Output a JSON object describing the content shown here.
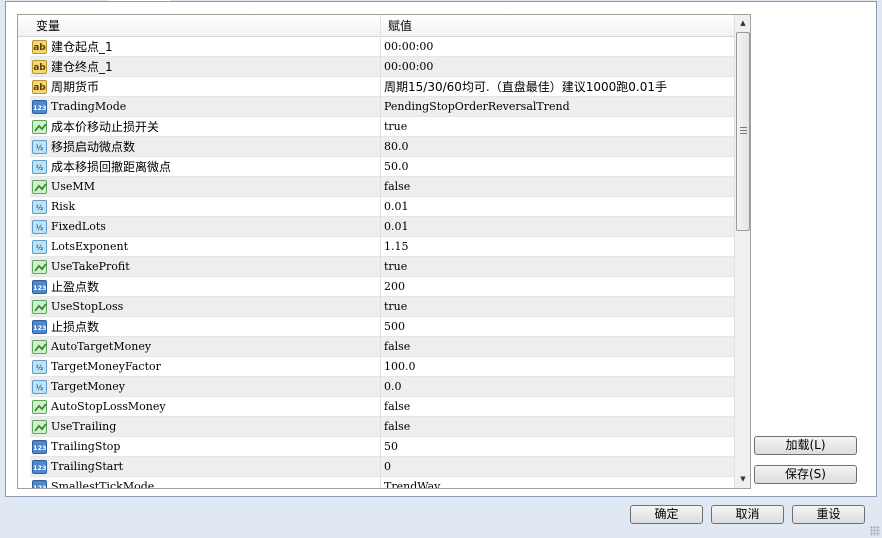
{
  "header": {
    "col_name": "变量",
    "col_value": "赋值"
  },
  "rows": [
    {
      "icon": "ab",
      "name": "建仓起点_1",
      "value": "00:00:00"
    },
    {
      "icon": "ab",
      "name": "建仓终点_1",
      "value": "00:00:00"
    },
    {
      "icon": "ab",
      "name": "周期货币",
      "value": "周期15/30/60均可.（直盘最佳）建议1000跑0.01手"
    },
    {
      "icon": "123",
      "name": "TradingMode",
      "value": "PendingStopOrderReversalTrend"
    },
    {
      "icon": "bool",
      "name": "成本价移动止损开关",
      "value": "true"
    },
    {
      "icon": "half",
      "name": "移损启动微点数",
      "value": "80.0"
    },
    {
      "icon": "half",
      "name": "成本移损回撤距离微点",
      "value": "50.0"
    },
    {
      "icon": "bool",
      "name": "UseMM",
      "value": "false"
    },
    {
      "icon": "half",
      "name": "Risk",
      "value": "0.01"
    },
    {
      "icon": "half",
      "name": "FixedLots",
      "value": "0.01"
    },
    {
      "icon": "half",
      "name": "LotsExponent",
      "value": "1.15"
    },
    {
      "icon": "bool",
      "name": "UseTakeProfit",
      "value": "true"
    },
    {
      "icon": "123",
      "name": "止盈点数",
      "value": "200"
    },
    {
      "icon": "bool",
      "name": "UseStopLoss",
      "value": "true"
    },
    {
      "icon": "123",
      "name": "止损点数",
      "value": "500"
    },
    {
      "icon": "bool",
      "name": "AutoTargetMoney",
      "value": "false"
    },
    {
      "icon": "half",
      "name": "TargetMoneyFactor",
      "value": "100.0"
    },
    {
      "icon": "half",
      "name": "TargetMoney",
      "value": "0.0"
    },
    {
      "icon": "bool",
      "name": "AutoStopLossMoney",
      "value": "false"
    },
    {
      "icon": "bool",
      "name": "UseTrailing",
      "value": "false"
    },
    {
      "icon": "123",
      "name": "TrailingStop",
      "value": "50"
    },
    {
      "icon": "123",
      "name": "TrailingStart",
      "value": "0"
    },
    {
      "icon": "123",
      "name": "SmallestTickMode",
      "value": "TrendWay"
    }
  ],
  "icon_labels": {
    "ab": "ab",
    "123": "123",
    "half": "½"
  },
  "buttons": {
    "load": "加载(L)",
    "save": "保存(S)",
    "ok": "确定",
    "cancel": "取消",
    "reset": "重设"
  }
}
